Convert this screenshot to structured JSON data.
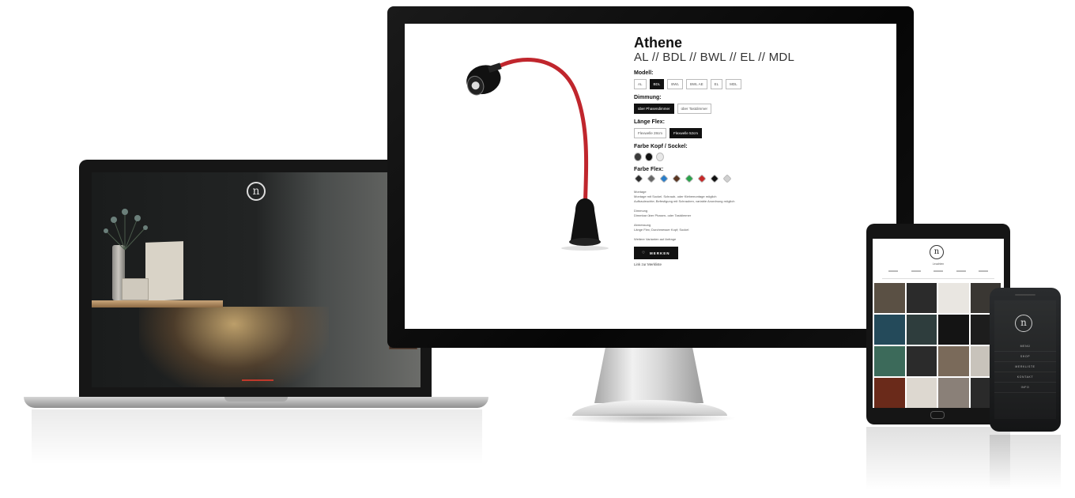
{
  "desktop": {
    "product": {
      "title": "Athene",
      "subtitle": "AL // BDL // BWL // EL // MDL"
    },
    "options": {
      "modell": {
        "label": "Modell:",
        "choices": [
          "AL",
          "BDL",
          "BWL",
          "BWL AE",
          "EL",
          "MDL"
        ],
        "selected": "BDL"
      },
      "dimmung": {
        "label": "Dimmung:",
        "choices": [
          "über Phasendimmer",
          "über Tastdimmer"
        ],
        "selected": "über Phasendimmer"
      },
      "laenge_flex": {
        "label": "Länge Flex:",
        "choices": [
          "Flexwelle 28cm",
          "Flexwelle 52cm"
        ],
        "selected": "Flexwelle 52cm"
      },
      "farbe_kopf_sockel": {
        "label": "Farbe Kopf / Sockel:",
        "colors": [
          "#3a3a3a",
          "#111111",
          "#e8e8e8"
        ]
      },
      "farbe_flex": {
        "label": "Farbe Flex:",
        "colors": [
          "#2a2a2a",
          "#666666",
          "#2a7ec9",
          "#5a3520",
          "#2aa24a",
          "#c62828",
          "#111111",
          "#d0d0d0"
        ]
      }
    },
    "description": {
      "montage_title": "Montage",
      "montage_text": "Montage mit Sockel. Schraub- oder Klebemontage möglich",
      "aufbau_text": "Aufbauleuchte; Befestigung mit Schrauben, variable Anordnung möglich",
      "dimmung_title": "Dimmung",
      "dimmung_text": "Dimmbar über Phasen- oder Tastdimmer",
      "abmessung_title": "Abmessung",
      "abmessung_text": "Länge Flex; Durchmesser Kopf; Sockel",
      "extra_text": "Weitere Varianten auf Anfrage"
    },
    "merken_label": "MERKEN",
    "merkliste_link": "Link zur Merkliste"
  },
  "laptop": {
    "logo": "n"
  },
  "tablet": {
    "logo": "n",
    "tagline": "Leuchten",
    "grid_colors": [
      "#5a5044",
      "#2b2b2b",
      "#e9e6e1",
      "#3a3733",
      "#244a5a",
      "#2e3d3d",
      "#141414",
      "#1d1d1d",
      "#3c6a5a",
      "#2b2b2b",
      "#7a6a5a",
      "#c8c3bb",
      "#6a2a1a",
      "#ddd8d0",
      "#8a8078",
      "#2a2a2a",
      "#1a1410",
      "#e1ddd5",
      "#c9c4bb",
      "#3a3530"
    ]
  },
  "phone": {
    "logo": "n",
    "menu": [
      "MENÜ",
      "SHOP",
      "MERKLISTE",
      "KONTAKT",
      "INFO"
    ]
  }
}
